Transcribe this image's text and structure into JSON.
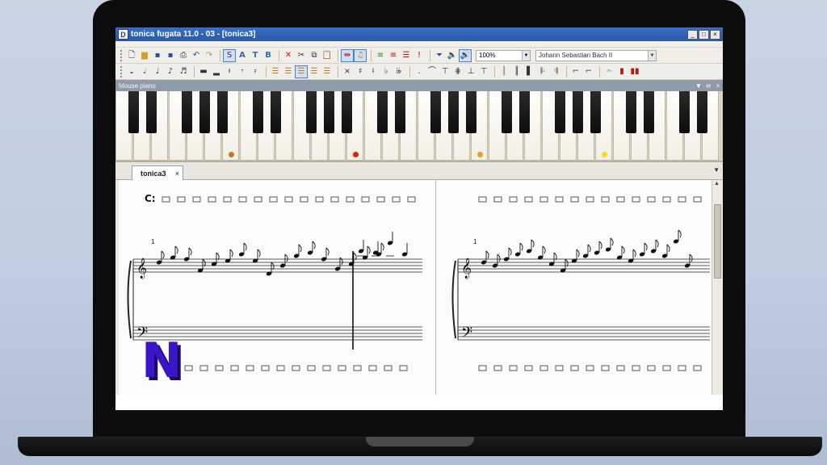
{
  "window": {
    "app_icon_label": "D",
    "title": "tonica fugata 11.0 - 03 - [tonica3]",
    "buttons": {
      "minimize": "_",
      "restore": "□",
      "close": "×"
    }
  },
  "toolbar1": {
    "zoom_value": "100%",
    "font_value": "Johann Sebastian Bach II"
  },
  "panel": {
    "title": "Mouse piano",
    "pin": "ㅂ",
    "close": "×"
  },
  "piano": {
    "highlighted_keys": [
      {
        "key": 6,
        "color": "#c07a20"
      },
      {
        "key": 13,
        "color": "#e02010"
      },
      {
        "key": 20,
        "color": "#e8a020"
      },
      {
        "key": 27,
        "color": "#f0e020"
      }
    ]
  },
  "tabs": {
    "active": "tonica3",
    "close": "×",
    "scroll_arrow": "▼"
  },
  "score": {
    "chord_symbol": "C:",
    "measure_number_left": "1",
    "measure_number_right": "1",
    "logo_letter": "N"
  },
  "colors": {
    "titlebar": "#2858aa",
    "panel_header": "#8f9bab",
    "logo": "#3a16c8"
  }
}
